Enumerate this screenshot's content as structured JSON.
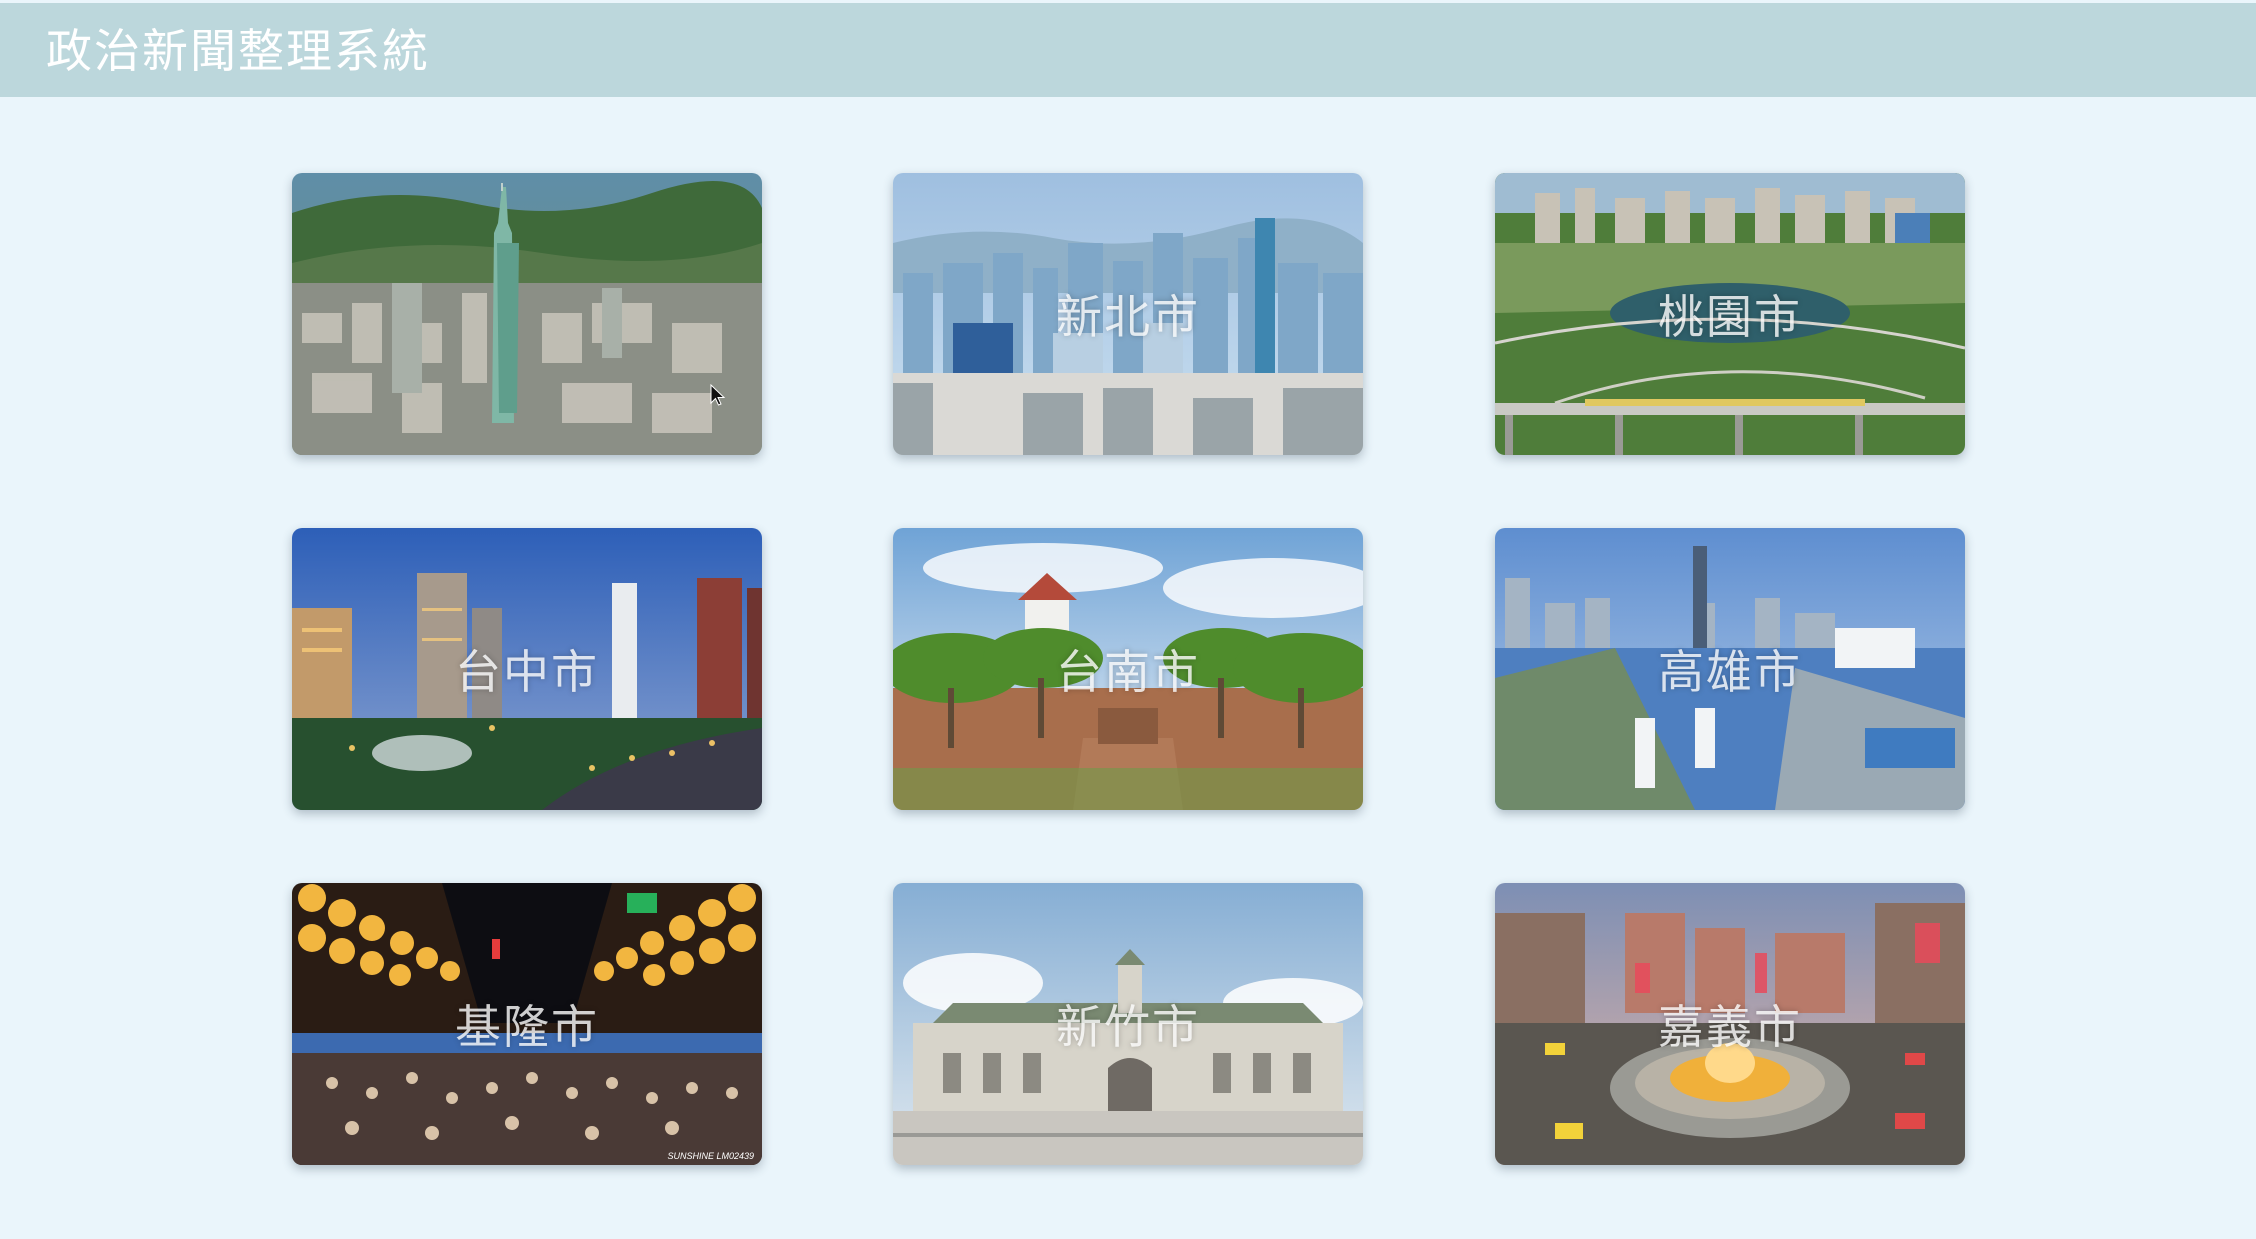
{
  "header": {
    "title": "政治新聞整理系統"
  },
  "cities": [
    {
      "label": "",
      "scene": "taipei-101-aerial-photo"
    },
    {
      "label": "新北市",
      "scene": "new-taipei-skyline-photo"
    },
    {
      "label": "桃園市",
      "scene": "taoyuan-park-metro-photo"
    },
    {
      "label": "台中市",
      "scene": "taichung-night-skyline-photo"
    },
    {
      "label": "台南市",
      "scene": "tainan-anping-fort-photo"
    },
    {
      "label": "高雄市",
      "scene": "kaohsiung-harbor-photo"
    },
    {
      "label": "基隆市",
      "scene": "keelung-night-market-photo"
    },
    {
      "label": "新竹市",
      "scene": "hsinchu-station-photo"
    },
    {
      "label": "嘉義市",
      "scene": "chiayi-fountain-roundabout-photo"
    }
  ],
  "watermark": "SUNSHINE LM02439",
  "colors": {
    "header": "#bcd7dc",
    "background": "#eaf5fb",
    "label": "#ffffff"
  }
}
